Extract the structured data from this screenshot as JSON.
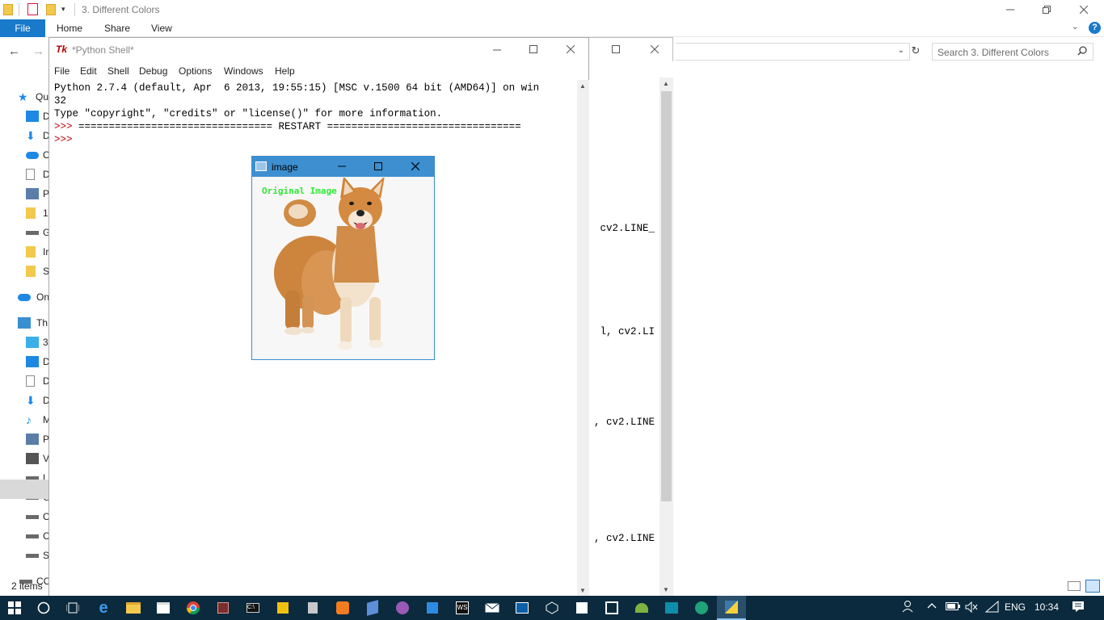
{
  "explorer": {
    "title": "3. Different Colors",
    "ribbon": {
      "file": "File",
      "home": "Home",
      "share": "Share",
      "view": "View"
    },
    "search_placeholder": "Search 3. Different Colors",
    "status": "2 items",
    "nav_items": [
      {
        "label": "Qu",
        "icon": "star-icon"
      },
      {
        "label": "D",
        "icon": "desktop-icon"
      },
      {
        "label": "D",
        "icon": "download-icon"
      },
      {
        "label": "O",
        "icon": "cloud-icon"
      },
      {
        "label": "D",
        "icon": "document-icon"
      },
      {
        "label": "P",
        "icon": "picture-icon"
      },
      {
        "label": "1",
        "icon": "folder-icon"
      },
      {
        "label": "G",
        "icon": "drive-icon"
      },
      {
        "label": "Ir",
        "icon": "folder-icon"
      },
      {
        "label": "S",
        "icon": "folder-icon"
      },
      {
        "label": "On",
        "icon": "onedrive-icon"
      },
      {
        "label": "Th",
        "icon": "pc-icon"
      },
      {
        "label": "3",
        "icon": "3d-objects-icon"
      },
      {
        "label": "D",
        "icon": "desktop-icon"
      },
      {
        "label": "D",
        "icon": "document-icon"
      },
      {
        "label": "D",
        "icon": "download-icon"
      },
      {
        "label": "M",
        "icon": "music-icon"
      },
      {
        "label": "P",
        "icon": "picture-icon"
      },
      {
        "label": "V",
        "icon": "video-icon"
      },
      {
        "label": "L",
        "icon": "drive-icon"
      },
      {
        "label": "G",
        "icon": "drive-icon"
      },
      {
        "label": "C",
        "icon": "drive-icon"
      },
      {
        "label": "C",
        "icon": "drive-icon"
      },
      {
        "label": "S",
        "icon": "drive-icon"
      },
      {
        "label": "CC",
        "icon": "drive-icon"
      }
    ],
    "code_fragments": [
      "cv2.LINE_",
      "l, cv2.LI",
      ", cv2.LINE",
      ", cv2.LINE"
    ]
  },
  "shell": {
    "title": "*Python Shell*",
    "menu": [
      "File",
      "Edit",
      "Shell",
      "Debug",
      "Options",
      "Windows",
      "Help"
    ],
    "lines": {
      "l1": "Python 2.7.4 (default, Apr  6 2013, 19:55:15) [MSC v.1500 64 bit (AMD64)] on win",
      "l2": "32",
      "l3": "Type \"copyright\", \"credits\" or \"license()\" for more information.",
      "l4_prompt": ">>> ",
      "l4_text": "================================ RESTART ================================",
      "l5_prompt": ">>> "
    }
  },
  "image_window": {
    "title": "image",
    "overlay_text": "Original Image",
    "overlay_color": "#2eea35",
    "subject": "shiba-inu-dog"
  },
  "taskbar": {
    "language": "ENG",
    "time": "10:34",
    "apps": [
      "start-icon",
      "cortana-icon",
      "task-view-icon",
      "edge-icon",
      "file-explorer-icon",
      "store-icon",
      "chrome-icon",
      "app-icon",
      "cmd-icon",
      "app-icon",
      "app-icon",
      "xampp-icon",
      "app-icon",
      "app-icon",
      "app-icon",
      "app-icon",
      "mail-icon",
      "app-icon",
      "app-icon",
      "app-icon",
      "visual-studio-icon",
      "android-studio-icon",
      "powershell-icon",
      "app-icon",
      "python-icon"
    ]
  },
  "colors": {
    "accent": "#1979ca",
    "taskbar": "#0b2a3e",
    "prompt": "#c00000"
  }
}
